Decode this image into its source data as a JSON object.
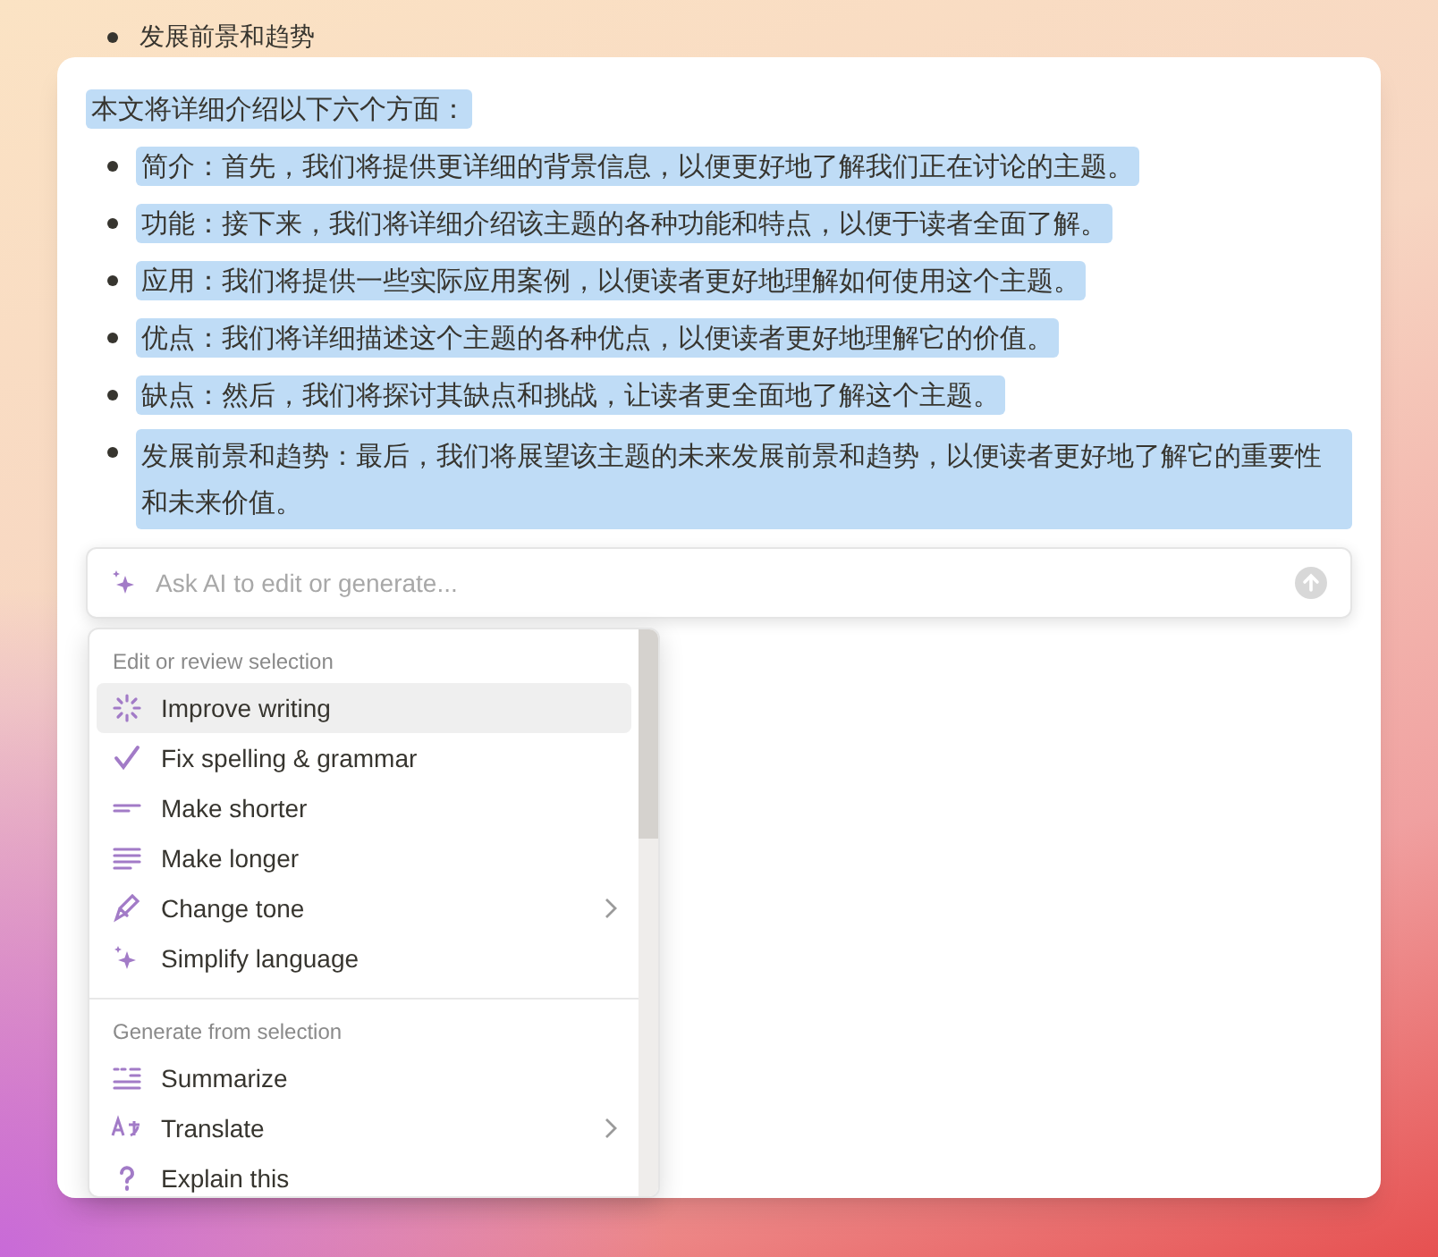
{
  "document": {
    "cut_bullet": "发展前景和趋势",
    "intro": {
      "text": "本文将详细介绍以下六个方面：",
      "selected": true
    },
    "bullets": [
      {
        "text": "简介：首先，我们将提供更详细的背景信息，以便更好地了解我们正在讨论的主题。",
        "selected": true
      },
      {
        "text": "功能：接下来，我们将详细介绍该主题的各种功能和特点，以便于读者全面了解。",
        "selected": true
      },
      {
        "text": "应用：我们将提供一些实际应用案例，以便读者更好地理解如何使用这个主题。",
        "selected": true
      },
      {
        "text": "优点：我们将详细描述这个主题的各种优点，以便读者更好地理解它的价值。",
        "selected": true
      },
      {
        "text": "缺点：然后，我们将探讨其缺点和挑战，让读者更全面地了解这个主题。",
        "selected": true
      },
      {
        "text": "发展前景和趋势：最后，我们将展望该主题的未来发展前景和趋势，以便读者更好地了解它的重要性和未来价值。",
        "selected": true
      }
    ]
  },
  "ai_input": {
    "placeholder": "Ask AI to edit or generate..."
  },
  "menu": {
    "sections": [
      {
        "heading": "Edit or review selection",
        "items": [
          {
            "label": "Improve writing",
            "selected": true,
            "submenu": false
          },
          {
            "label": "Fix spelling & grammar",
            "selected": false,
            "submenu": false
          },
          {
            "label": "Make shorter",
            "selected": false,
            "submenu": false
          },
          {
            "label": "Make longer",
            "selected": false,
            "submenu": false
          },
          {
            "label": "Change tone",
            "selected": false,
            "submenu": true
          },
          {
            "label": "Simplify language",
            "selected": false,
            "submenu": false
          }
        ]
      },
      {
        "heading": "Generate from selection",
        "items": [
          {
            "label": "Summarize",
            "selected": false,
            "submenu": false
          },
          {
            "label": "Translate",
            "selected": false,
            "submenu": true
          },
          {
            "label": "Explain this",
            "selected": false,
            "submenu": false
          }
        ]
      }
    ]
  }
}
